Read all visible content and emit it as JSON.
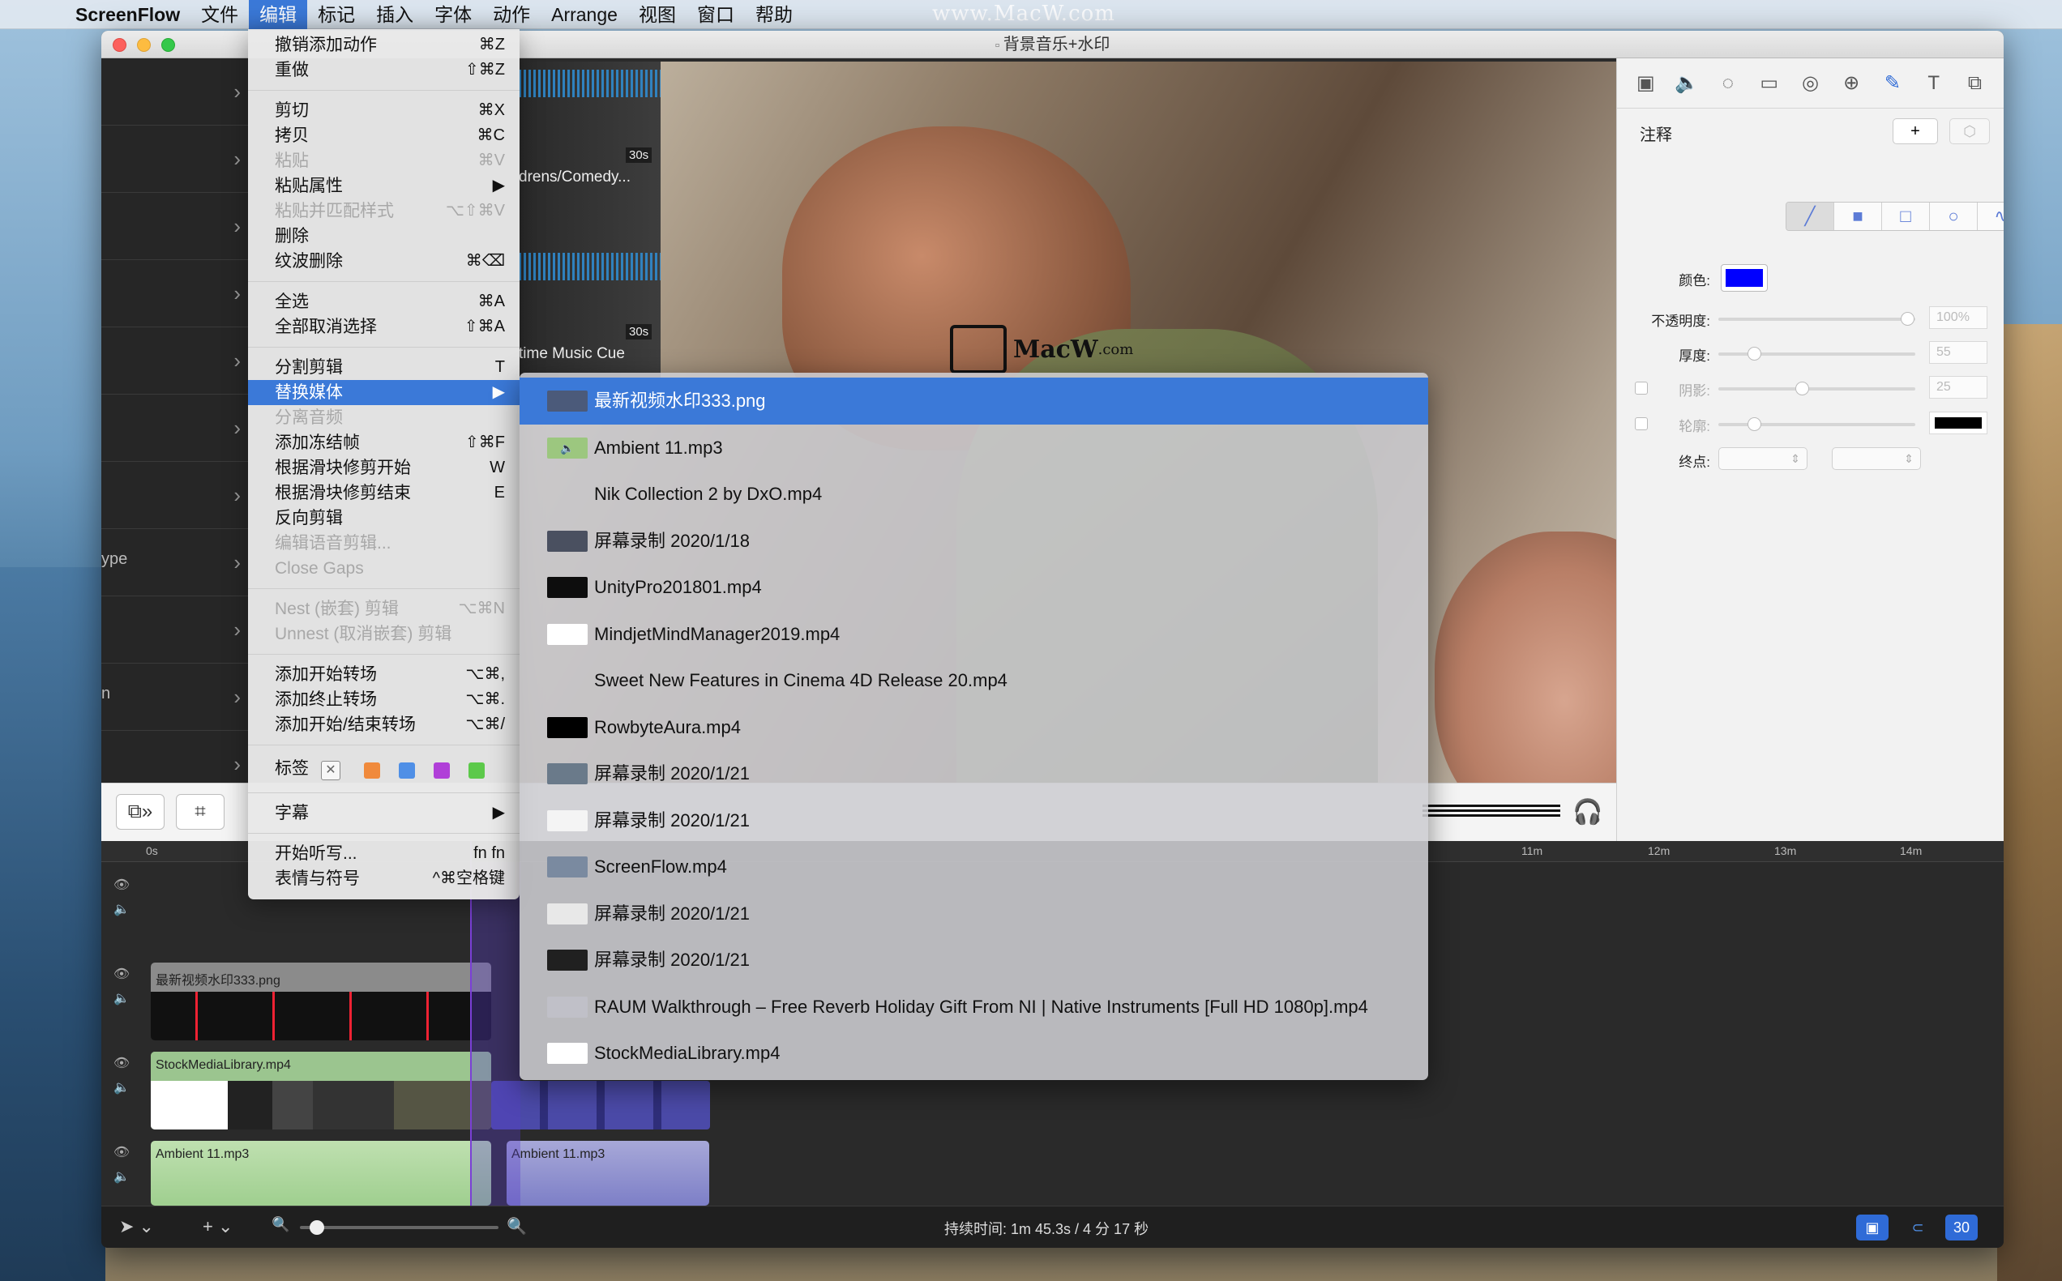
{
  "menubar": {
    "app_name": "ScreenFlow",
    "items": [
      "文件",
      "编辑",
      "标记",
      "插入",
      "字体",
      "动作",
      "Arrange",
      "视图",
      "窗口",
      "帮助"
    ],
    "active_item": "编辑",
    "watermark": "www.MacW.com"
  },
  "window": {
    "title": "背景音乐+水印"
  },
  "media_panel": {
    "fragments": [
      "ype",
      "n"
    ]
  },
  "canvas": {
    "clip1_label": "drens/Comedy...",
    "clip1_dur": "30s",
    "clip2_label": "time Music Cue",
    "clip2_dur": "30s",
    "logo_text": "MacW",
    "logo_suffix": ".com"
  },
  "inspector": {
    "title": "注释",
    "add_label": "+",
    "rows": {
      "color_label": "颜色:",
      "opacity_label": "不透明度:",
      "opacity_value": "100%",
      "thickness_label": "厚度:",
      "thickness_value": "55",
      "shadow_label": "阴影:",
      "shadow_value": "25",
      "outline_label": "轮廓:",
      "endpoint_label": "终点:"
    },
    "colors": {
      "annotation": "#0000ff",
      "outline": "#000000"
    }
  },
  "edit_menu": {
    "groups": [
      [
        {
          "label": "撤销添加动作",
          "shortcut": "⌘Z",
          "enabled": true
        },
        {
          "label": "重做",
          "shortcut": "⇧⌘Z",
          "enabled": true
        }
      ],
      [
        {
          "label": "剪切",
          "shortcut": "⌘X",
          "enabled": true
        },
        {
          "label": "拷贝",
          "shortcut": "⌘C",
          "enabled": true
        },
        {
          "label": "粘贴",
          "shortcut": "⌘V",
          "enabled": false
        },
        {
          "label": "粘贴属性",
          "shortcut": "▶",
          "enabled": true
        },
        {
          "label": "粘贴并匹配样式",
          "shortcut": "⌥⇧⌘V",
          "enabled": false
        },
        {
          "label": "删除",
          "shortcut": "",
          "enabled": true
        },
        {
          "label": "纹波删除",
          "shortcut": "⌘⌫",
          "enabled": true
        }
      ],
      [
        {
          "label": "全选",
          "shortcut": "⌘A",
          "enabled": true
        },
        {
          "label": "全部取消选择",
          "shortcut": "⇧⌘A",
          "enabled": true
        }
      ],
      [
        {
          "label": "分割剪辑",
          "shortcut": "T",
          "enabled": true
        },
        {
          "label": "替换媒体",
          "shortcut": "▶",
          "enabled": true,
          "selected": true
        },
        {
          "label": "分离音频",
          "shortcut": "",
          "enabled": false
        },
        {
          "label": "添加冻结帧",
          "shortcut": "⇧⌘F",
          "enabled": true
        },
        {
          "label": "根据滑块修剪开始",
          "shortcut": "W",
          "enabled": true
        },
        {
          "label": "根据滑块修剪结束",
          "shortcut": "E",
          "enabled": true
        },
        {
          "label": "反向剪辑",
          "shortcut": "",
          "enabled": true
        },
        {
          "label": "编辑语音剪辑...",
          "shortcut": "",
          "enabled": false
        },
        {
          "label": "Close Gaps",
          "shortcut": "",
          "enabled": false
        }
      ],
      [
        {
          "label": "Nest (嵌套) 剪辑",
          "shortcut": "⌥⌘N",
          "enabled": false
        },
        {
          "label": "Unnest (取消嵌套) 剪辑",
          "shortcut": "",
          "enabled": false
        }
      ],
      [
        {
          "label": "添加开始转场",
          "shortcut": "⌥⌘,",
          "enabled": true
        },
        {
          "label": "添加终止转场",
          "shortcut": "⌥⌘.",
          "enabled": true
        },
        {
          "label": "添加开始/结束转场",
          "shortcut": "⌥⌘/",
          "enabled": true
        }
      ]
    ],
    "labels_title": "标签",
    "label_colors": [
      "#f08a3c",
      "#4f8fe6",
      "#b03fd8",
      "#5cc94a"
    ],
    "subtitles": {
      "label": "字幕",
      "shortcut": "▶"
    },
    "dictation": {
      "label": "开始听写...",
      "shortcut": "fn fn"
    },
    "emoji": {
      "label": "表情与符号",
      "shortcut": "^⌘空格键"
    }
  },
  "replace_media_submenu": [
    {
      "label": "最新视频水印333.png",
      "thumb": "#4b5a7a",
      "selected": true
    },
    {
      "label": "Ambient 11.mp3",
      "thumb": "#9cc77f"
    },
    {
      "label": "Nik Collection 2 by DxO.mp4",
      "thumb": ""
    },
    {
      "label": "屏幕录制 2020/1/18",
      "thumb": "#4a5060"
    },
    {
      "label": "UnityPro201801.mp4",
      "thumb": "#0d0d0d"
    },
    {
      "label": "MindjetMindManager2019.mp4",
      "thumb": "#ffffff"
    },
    {
      "label": "Sweet New Features in Cinema 4D Release 20.mp4",
      "thumb": ""
    },
    {
      "label": "RowbyteAura.mp4",
      "thumb": "#000000"
    },
    {
      "label": "屏幕录制 2020/1/21",
      "thumb": "#6a7a8a"
    },
    {
      "label": "屏幕录制 2020/1/21",
      "thumb": "#f4f4f4"
    },
    {
      "label": "ScreenFlow.mp4",
      "thumb": "#7a8aa0"
    },
    {
      "label": "屏幕录制 2020/1/21",
      "thumb": "#e8e8e8"
    },
    {
      "label": "屏幕录制 2020/1/21",
      "thumb": "#202020"
    },
    {
      "label": "RAUM Walkthrough – Free Reverb Holiday Gift From NI | Native Instruments [Full HD 1080p].mp4",
      "thumb": "#c0c0c8"
    },
    {
      "label": "StockMediaLibrary.mp4",
      "thumb": "#ffffff"
    }
  ],
  "timeline": {
    "ruler": [
      "0s",
      "11m",
      "12m",
      "13m",
      "14m"
    ],
    "clips": {
      "image_clip": "最新视频水印333.png",
      "video_clip": "StockMediaLibrary.mp4",
      "audio_clip": "Ambient 11.mp3",
      "audio_clip2": "Ambient 11.mp3"
    }
  },
  "statusbar": {
    "duration": "持续时间: 1m 45.3s  /  4 分 17 秒",
    "fps": "30"
  }
}
